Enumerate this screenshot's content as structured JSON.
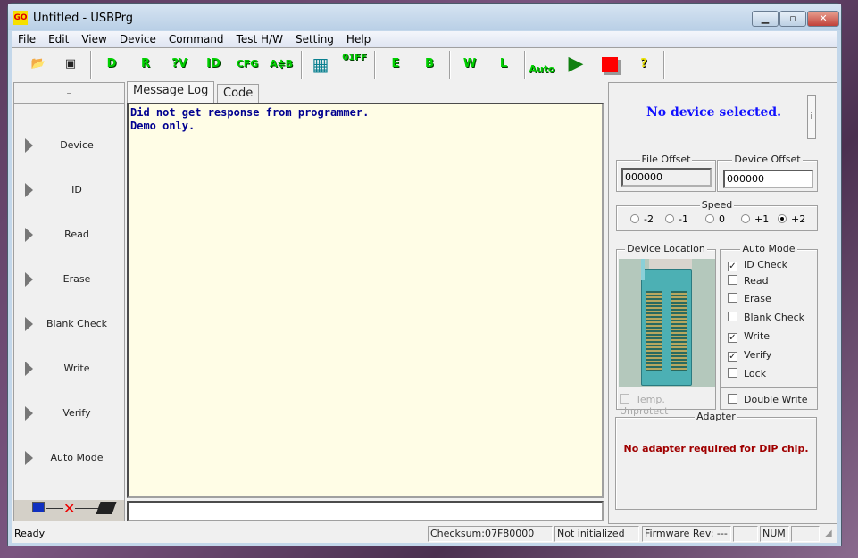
{
  "window": {
    "title": "Untitled - USBPrg",
    "app_icon": "GO",
    "minimize": "minimize-icon",
    "maximize": "maximize-icon",
    "close": "close-icon"
  },
  "menu": [
    "File",
    "Edit",
    "View",
    "Device",
    "Command",
    "Test H/W",
    "Setting",
    "Help"
  ],
  "toolbar": {
    "open": "open-folder-icon",
    "save": "save-disk-icon",
    "device": "D",
    "read": "R",
    "verify": "?V",
    "id": "ID",
    "config": "CFG",
    "compare": "A≑B",
    "buffer": "calculator-icon",
    "fill": "01FF",
    "erase": "E",
    "blank": "B",
    "write": "W",
    "lock": "L",
    "auto": "Auto",
    "run": "play-icon",
    "stop": "stop-icon",
    "help": "?"
  },
  "left_panel": {
    "header": "–",
    "items": [
      "Device",
      "ID",
      "Read",
      "Erase",
      "Blank Check",
      "Write",
      "Verify",
      "Auto Mode"
    ]
  },
  "tabs": [
    "Message Log",
    "Code"
  ],
  "log": "Did not get response from programmer.\nDemo only.",
  "right": {
    "device_status": "No device selected.",
    "info_button": "i",
    "file_offset_label": "File Offset",
    "file_offset": "000000",
    "device_offset_label": "Device Offset",
    "device_offset": "000000",
    "speed_label": "Speed",
    "speed_options": [
      "-2",
      "-1",
      "0",
      "+1",
      "+2"
    ],
    "speed_selected": "+2",
    "device_location_label": "Device Location",
    "temp_unprotect": "Temp. Unprotect",
    "auto_mode_label": "Auto Mode",
    "auto_mode": [
      {
        "label": "ID Check",
        "checked": true
      },
      {
        "label": "Read",
        "checked": false
      },
      {
        "label": "Erase",
        "checked": false
      },
      {
        "label": "Blank Check",
        "checked": false
      },
      {
        "label": "Write",
        "checked": true
      },
      {
        "label": "Verify",
        "checked": true
      },
      {
        "label": "Lock",
        "checked": false
      }
    ],
    "double_write": "Double Write",
    "adapter_label": "Adapter",
    "adapter_text": "No adapter required for DIP chip."
  },
  "status": {
    "ready": "Ready",
    "checksum": "Checksum:07F80000",
    "init": "Not initialized",
    "firmware": "Firmware Rev: ---",
    "num": "NUM"
  }
}
